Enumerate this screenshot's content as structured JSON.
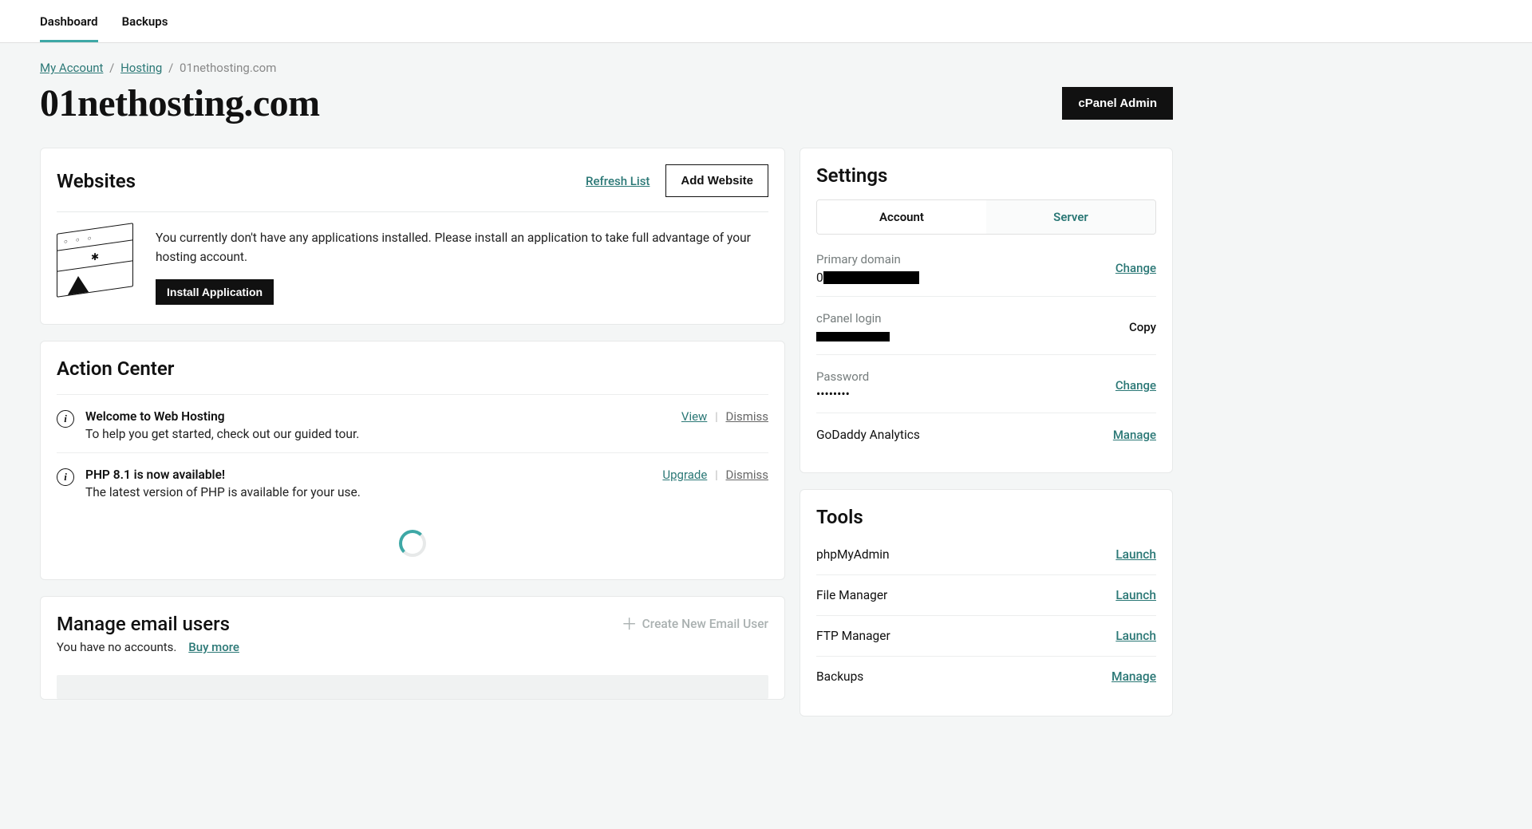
{
  "topTabs": {
    "dashboard": "Dashboard",
    "backups": "Backups"
  },
  "breadcrumb": {
    "myAccount": "My Account",
    "hosting": "Hosting",
    "current": "01nethosting.com"
  },
  "pageTitle": "01nethosting.com",
  "cpanelAdmin": "cPanel Admin",
  "websites": {
    "heading": "Websites",
    "refresh": "Refresh List",
    "addWebsite": "Add Website",
    "emptyMsg": "You currently don't have any applications installed. Please install an application to take full advantage of your hosting account.",
    "installBtn": "Install Application"
  },
  "actionCenter": {
    "heading": "Action Center",
    "items": [
      {
        "title": "Welcome to Web Hosting",
        "desc": "To help you get started, check out our guided tour.",
        "primary": "View",
        "secondary": "Dismiss"
      },
      {
        "title": "PHP 8.1 is now available!",
        "desc": "The latest version of PHP is available for your use.",
        "primary": "Upgrade",
        "secondary": "Dismiss"
      }
    ]
  },
  "email": {
    "heading": "Manage email users",
    "noAccounts": "You have no accounts.",
    "buyMore": "Buy more",
    "createNew": "Create New Email User"
  },
  "settings": {
    "heading": "Settings",
    "tabs": {
      "account": "Account",
      "server": "Server"
    },
    "primaryDomain": {
      "label": "Primary domain",
      "action": "Change"
    },
    "cpanelLogin": {
      "label": "cPanel login",
      "action": "Copy"
    },
    "password": {
      "label": "Password",
      "masked": "••••••••",
      "action": "Change"
    },
    "analytics": {
      "label": "GoDaddy Analytics",
      "action": "Manage"
    }
  },
  "tools": {
    "heading": "Tools",
    "items": [
      {
        "name": "phpMyAdmin",
        "action": "Launch"
      },
      {
        "name": "File Manager",
        "action": "Launch"
      },
      {
        "name": "FTP Manager",
        "action": "Launch"
      },
      {
        "name": "Backups",
        "action": "Manage"
      }
    ]
  }
}
